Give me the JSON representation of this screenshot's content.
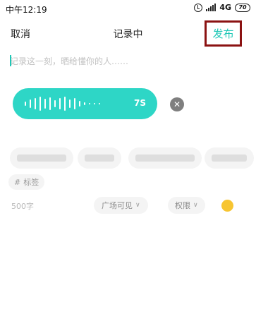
{
  "status_bar": {
    "time": "中午12:19",
    "network": "4G",
    "battery": "70"
  },
  "nav": {
    "cancel_label": "取消",
    "title": "记录中",
    "publish_label": "发布"
  },
  "post": {
    "placeholder": "记录这一刻，晒给懂你的人……"
  },
  "voice": {
    "duration": "7S"
  },
  "tag": {
    "label": "标签",
    "icon": "#"
  },
  "footer": {
    "char_count": "500字",
    "visibility_label": "广场可见",
    "permission_label": "权限"
  },
  "colors": {
    "accent": "#1fc7b6",
    "voice_pill": "#2ed6c6",
    "highlight_border": "#8b1212",
    "emoji": "#f7c531"
  }
}
